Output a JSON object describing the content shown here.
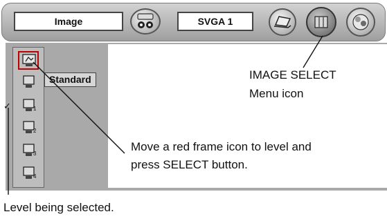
{
  "menu_bar": {
    "image_field": "Image",
    "mode_field": "SVGA 1"
  },
  "side_menu": {
    "selected_label": "Standard",
    "levels": [
      {
        "name": "standard",
        "suffix": ""
      },
      {
        "name": "level-blank",
        "suffix": ""
      },
      {
        "name": "level-1",
        "suffix": "1"
      },
      {
        "name": "level-2",
        "suffix": "2"
      },
      {
        "name": "level-3",
        "suffix": "3"
      },
      {
        "name": "level-4",
        "suffix": "4"
      }
    ],
    "check_mark": "✓"
  },
  "callouts": {
    "menu_icon_line1": "IMAGE SELECT",
    "menu_icon_line2": "Menu icon",
    "move_line1": "Move a red frame icon to level and",
    "move_line2": "press SELECT button.",
    "level_selected": "Level being selected."
  },
  "colors": {
    "frame": "#c00000",
    "menu_background": "#a9a9a9",
    "bar": "#bdbdbd"
  }
}
